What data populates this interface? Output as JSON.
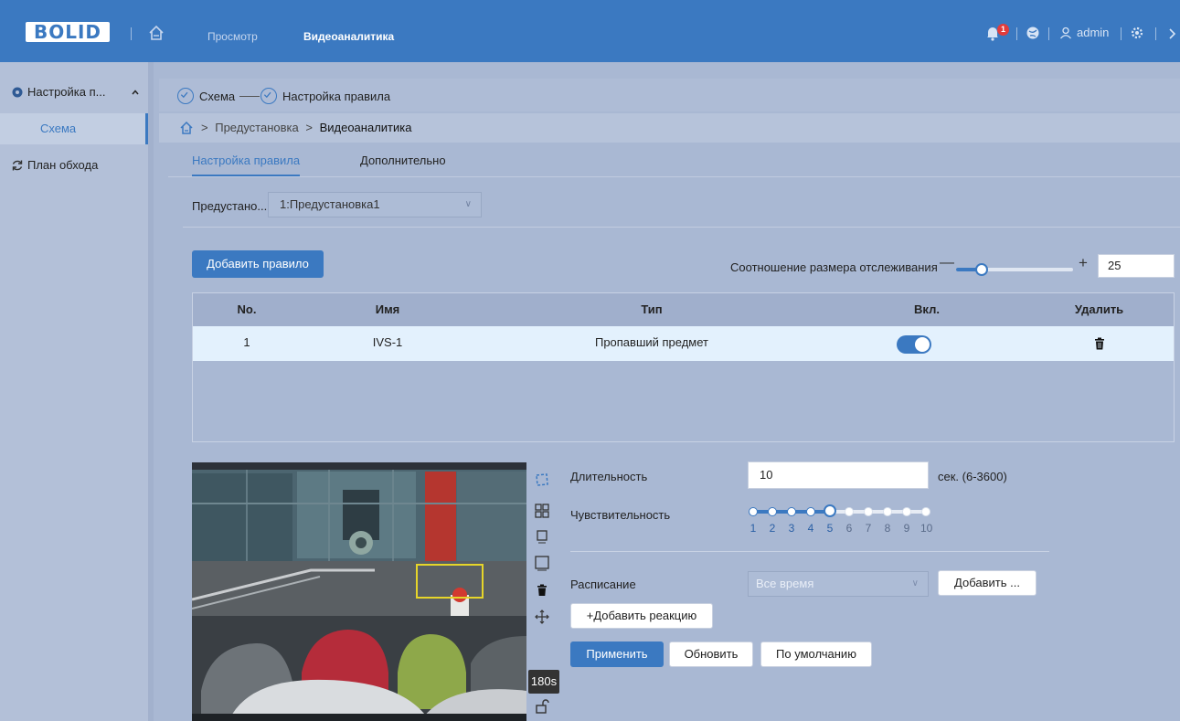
{
  "header": {
    "logo": "BOLID",
    "nav": {
      "view": "Просмотр",
      "video_analytics": "Видеоаналитика"
    },
    "notification_count": "1",
    "user": "admin"
  },
  "sidebar": {
    "group_label": "Настройка п...",
    "items": [
      {
        "label": "Схема"
      },
      {
        "label": "План обхода"
      }
    ]
  },
  "steps": {
    "step1": "Схема",
    "step2": "Настройка правила"
  },
  "breadcrumb": {
    "sep": ">",
    "preset": "Предустановка",
    "current": "Видеоаналитика"
  },
  "tabs": {
    "rule_setup": "Настройка правила",
    "advanced": "Дополнительно"
  },
  "preset": {
    "label": "Предустано...",
    "value": "1:Предустановка1"
  },
  "rules": {
    "add_button": "Добавить правило",
    "tracking_label": "Соотношение размера отслеживания",
    "tracking_value": "25",
    "tracking_fraction": 0.22,
    "columns": {
      "no": "No.",
      "name": "Имя",
      "type": "Тип",
      "enabled": "Вкл.",
      "delete": "Удалить"
    },
    "rows": [
      {
        "no": "1",
        "name": "IVS-1",
        "type": "Пропавший предмет",
        "enabled": true
      }
    ]
  },
  "camera": {
    "tooltip": "180s"
  },
  "params": {
    "duration_label": "Длительность",
    "duration_value": "10",
    "duration_unit": "сек. (6-3600)",
    "sensitivity_label": "Чувствительность",
    "sensitivity_value": 5,
    "sensitivity_scale": [
      "1",
      "2",
      "3",
      "4",
      "5",
      "6",
      "7",
      "8",
      "9",
      "10"
    ],
    "schedule_label": "Расписание",
    "schedule_value": "Все время",
    "schedule_add": "Добавить ...",
    "add_reaction": "+Добавить реакцию",
    "apply": "Применить",
    "refresh": "Обновить",
    "default": "По умолчанию"
  },
  "colors": {
    "accent": "#3b79c1",
    "background": "#a9b8d3",
    "badge": "#e23c3c"
  }
}
